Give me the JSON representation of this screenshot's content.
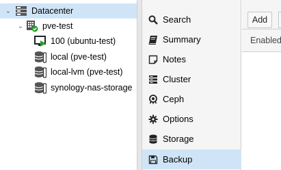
{
  "tree": {
    "datacenter": {
      "label": "Datacenter",
      "icon": "server-rack-icon"
    },
    "node": {
      "label": "pve-test",
      "icon": "node-online-icon",
      "status_color": "#21a32a"
    },
    "items": [
      {
        "label": "100 (ubuntu-test)",
        "icon": "vm-running-icon"
      },
      {
        "label": "local (pve-test)",
        "icon": "storage-icon"
      },
      {
        "label": "local-lvm (pve-test)",
        "icon": "storage-icon"
      },
      {
        "label": "synology-nas-storage",
        "icon": "storage-icon"
      }
    ]
  },
  "menu": {
    "items": [
      {
        "label": "Search",
        "icon": "search-icon"
      },
      {
        "label": "Summary",
        "icon": "book-icon"
      },
      {
        "label": "Notes",
        "icon": "note-icon"
      },
      {
        "label": "Cluster",
        "icon": "server-icon"
      },
      {
        "label": "Ceph",
        "icon": "ceph-icon"
      },
      {
        "label": "Options",
        "icon": "gear-icon"
      },
      {
        "label": "Storage",
        "icon": "database-icon"
      },
      {
        "label": "Backup",
        "icon": "floppy-icon",
        "active": true
      }
    ]
  },
  "panel": {
    "add_label": "Add",
    "column_enabled": "Enabled"
  },
  "colors": {
    "selection": "#cfe5f7",
    "menu_bg": "#f5f5f5",
    "running_green": "#21a32a"
  }
}
